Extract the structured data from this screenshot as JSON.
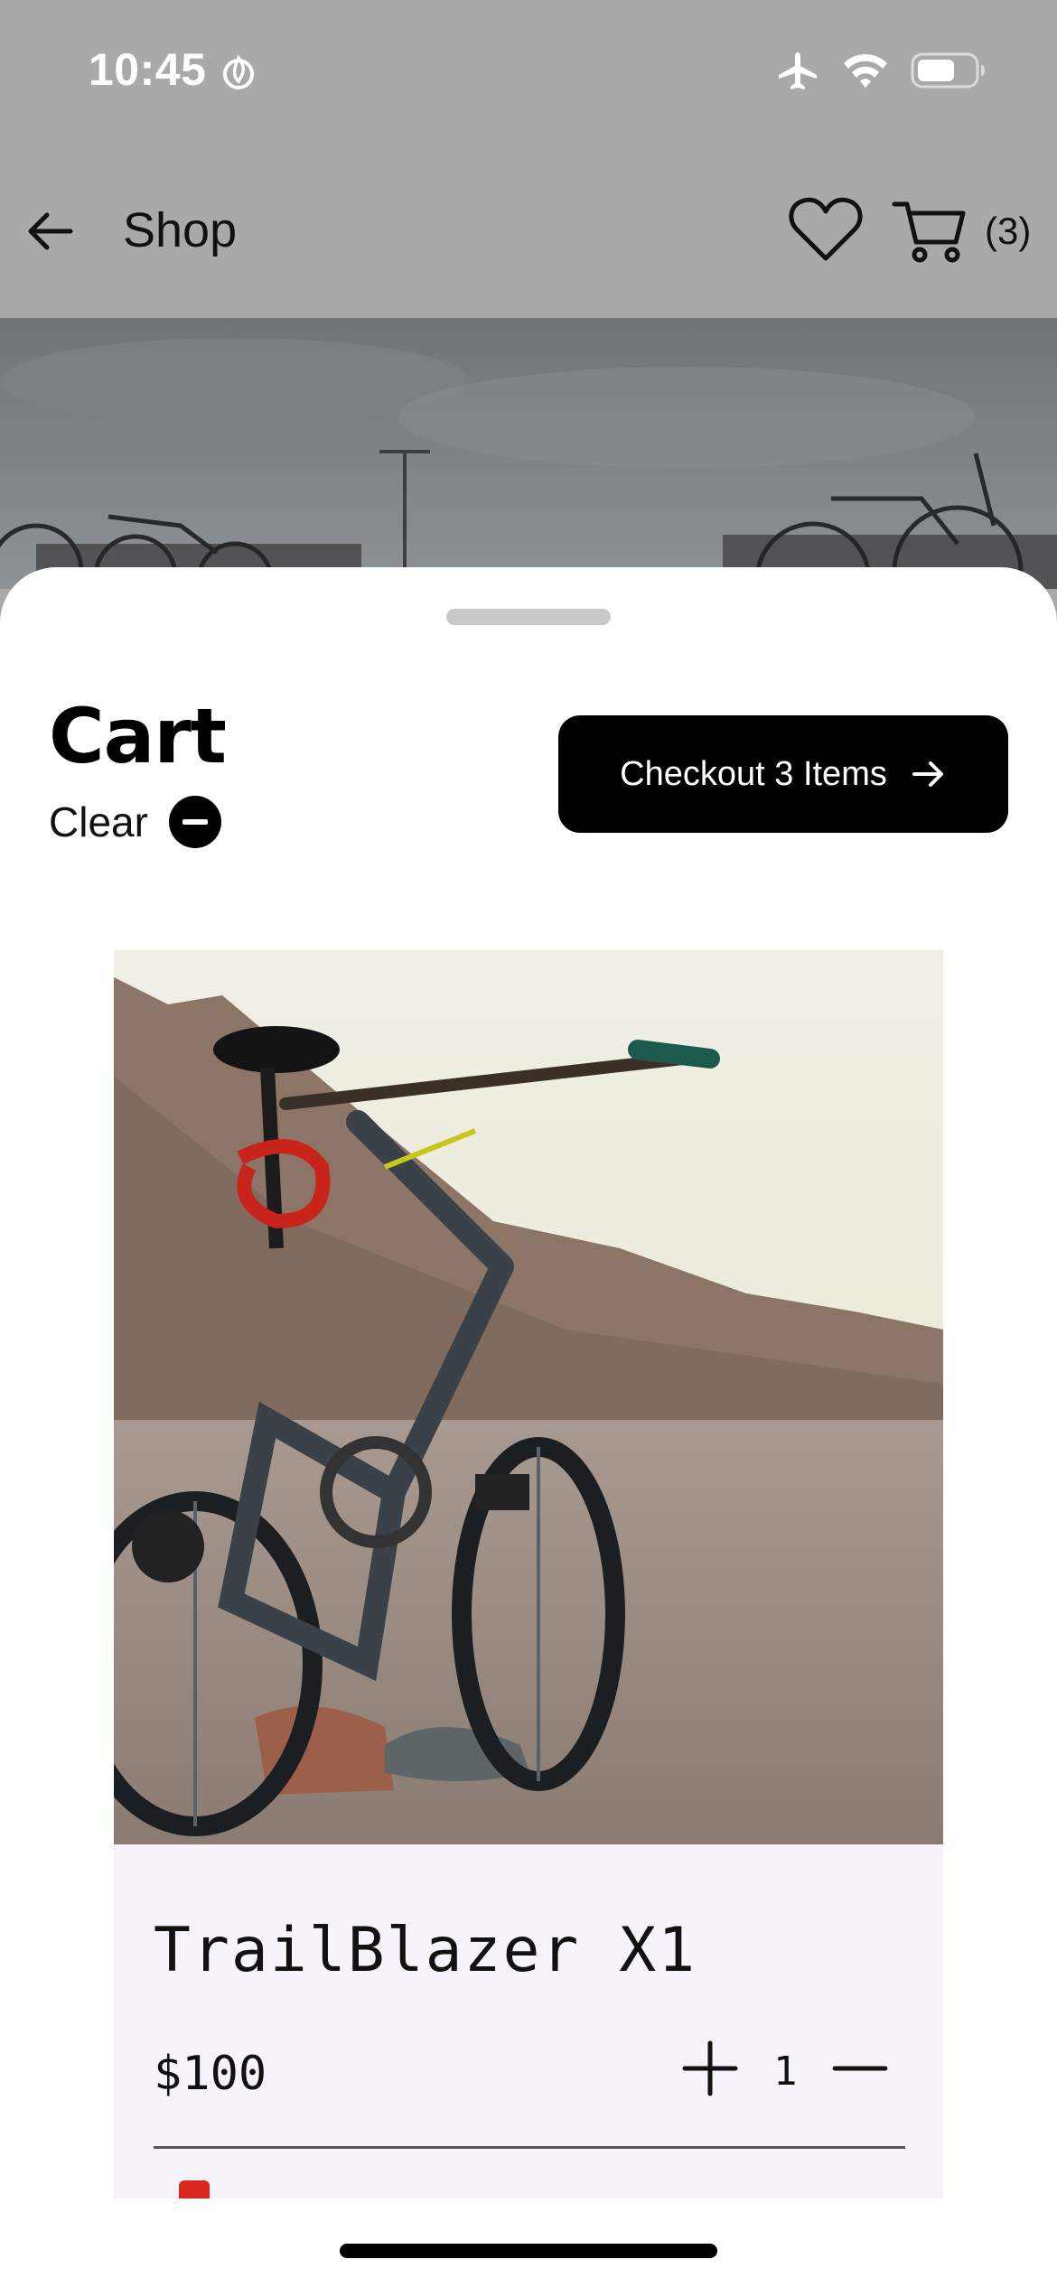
{
  "status_bar": {
    "time": "10:45",
    "time_icon": "flame-icon",
    "icons": [
      "airplane-icon",
      "wifi-icon",
      "battery-icon"
    ]
  },
  "nav": {
    "back_icon": "arrow-left-icon",
    "title": "Shop",
    "favorites_icon": "heart-icon",
    "cart_icon": "cart-icon",
    "cart_count": "(3)"
  },
  "sheet": {
    "title": "Cart",
    "clear_label": "Clear",
    "clear_icon": "minus-circle-icon",
    "checkout_label": "Checkout 3 Items",
    "checkout_icon": "arrow-right-icon"
  },
  "cart_items": [
    {
      "name": "TrailBlazer X1",
      "price": "$100",
      "quantity": "1",
      "increment_icon": "plus-icon",
      "decrement_icon": "minus-icon"
    }
  ],
  "colors": {
    "overlay": "#a9a9a9",
    "primary_button": "#000000",
    "card_background": "#f7f3fb",
    "sheet_background": "#ffffff"
  }
}
